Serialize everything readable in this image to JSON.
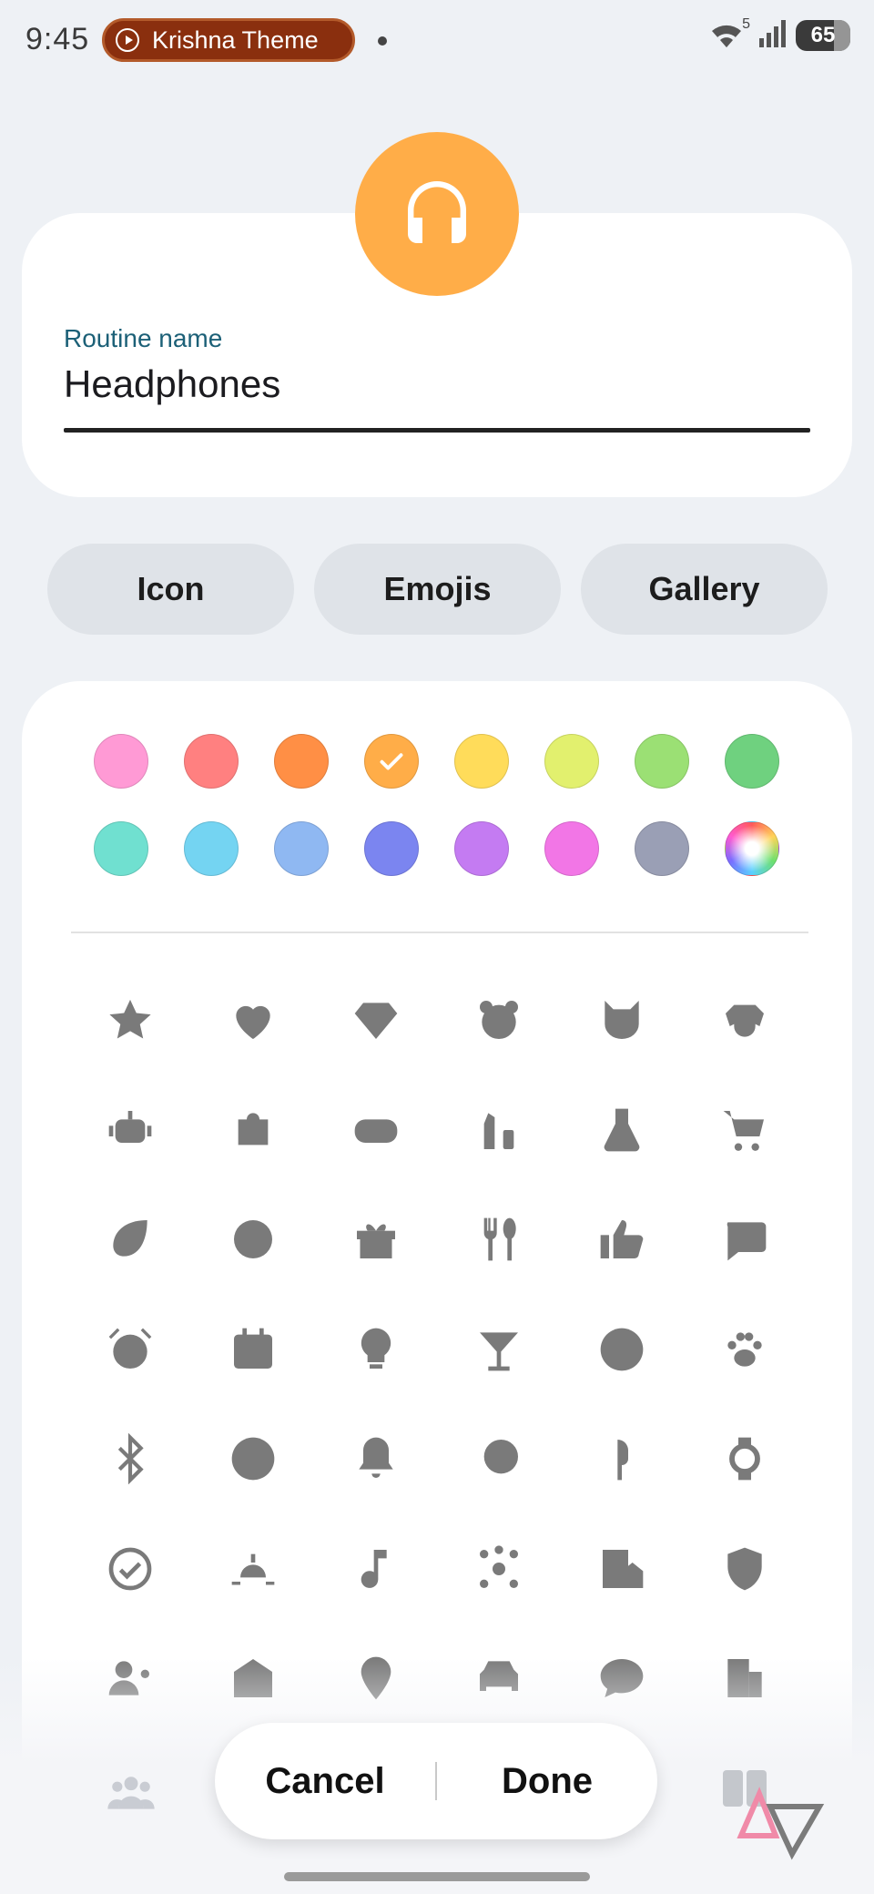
{
  "status_bar": {
    "time": "9:45",
    "media_title": "Krishna Theme",
    "wifi_superscript": "5",
    "battery": "65"
  },
  "routine": {
    "icon": "headphones-icon",
    "icon_color": "#ffad48",
    "name_label": "Routine name",
    "name_value": "Headphones"
  },
  "tabs": [
    {
      "label": "Icon"
    },
    {
      "label": "Emojis"
    },
    {
      "label": "Gallery"
    }
  ],
  "colors": {
    "selected_index": 3,
    "swatches": [
      "#ff9ad5",
      "#ff8080",
      "#ff8f45",
      "#ffad48",
      "#ffdc5a",
      "#e2f06e",
      "#9be074",
      "#6fd17f",
      "#70e0d0",
      "#74d4f2",
      "#8fb8f2",
      "#7b85f0",
      "#c47bf2",
      "#f276e6",
      "#9a9fb5",
      "multicolor-wheel"
    ]
  },
  "icons": [
    "star-icon",
    "heart-icon",
    "diamond-icon",
    "bear-icon",
    "cat-icon",
    "dog-icon",
    "robot-icon",
    "puzzle-icon",
    "gamepad-icon",
    "lipstick-icon",
    "flask-icon",
    "cart-icon",
    "leaf-icon",
    "baby-icon",
    "gift-icon",
    "cutlery-icon",
    "thumbs-up-icon",
    "chat-bubble-icon",
    "alarm-icon",
    "calendar-icon",
    "bulb-icon",
    "cocktail-icon",
    "basketball-icon",
    "paw-icon",
    "bluetooth-icon",
    "clock-icon",
    "bell-icon",
    "moon-icon",
    "earbud-icon",
    "watch-icon",
    "timer-check-icon",
    "sunrise-icon",
    "music-note-icon",
    "hub-icon",
    "home-building-icon",
    "shield-user-icon",
    "person-settings-icon",
    "arrival-icon",
    "location-pin-icon",
    "car-icon",
    "quote-bubble-icon",
    "building-icon"
  ],
  "actions": {
    "cancel": "Cancel",
    "done": "Done"
  }
}
